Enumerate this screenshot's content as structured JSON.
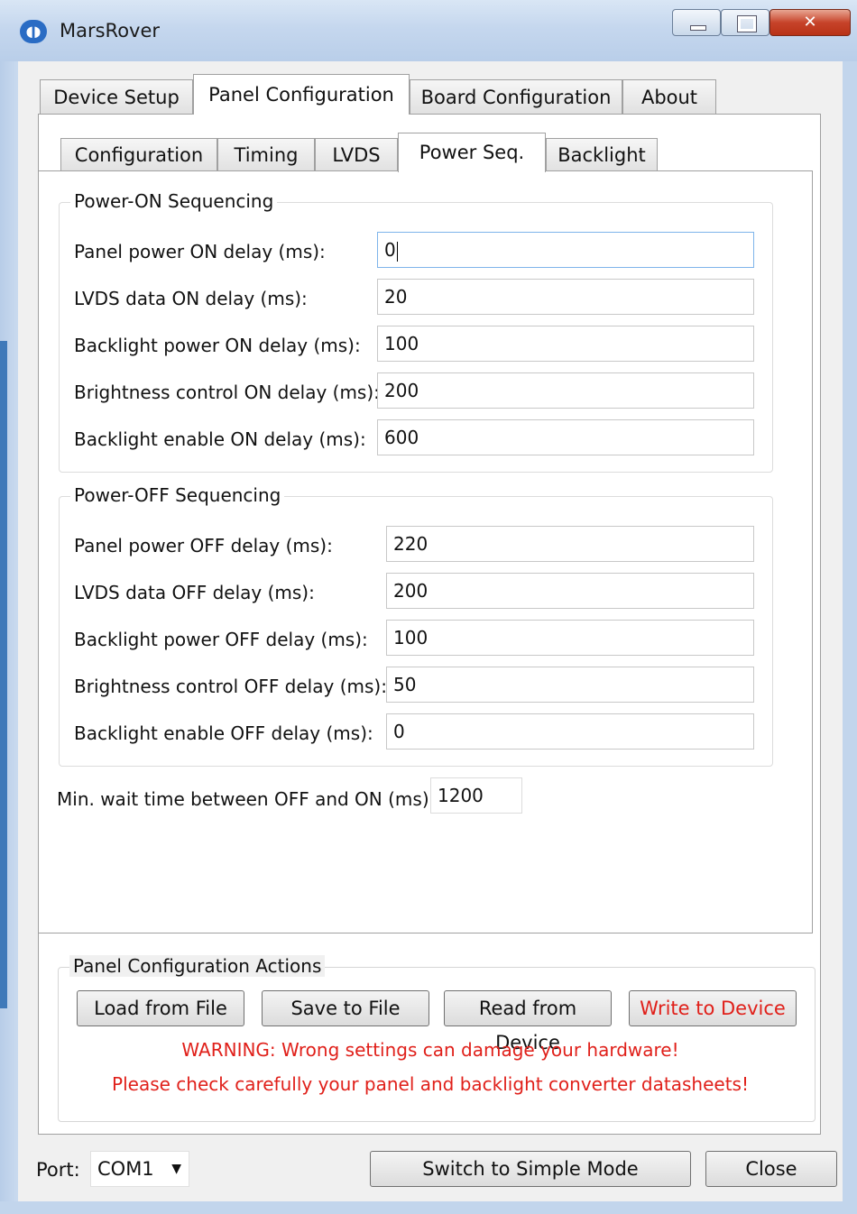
{
  "window": {
    "title": "MarsRover",
    "icon": "app-logo-icon"
  },
  "main_tabs": [
    {
      "label": "Device Setup",
      "active": false
    },
    {
      "label": "Panel Configuration",
      "active": true
    },
    {
      "label": "Board Configuration",
      "active": false
    },
    {
      "label": "About",
      "active": false
    }
  ],
  "sub_tabs": [
    {
      "label": "Configuration",
      "active": false
    },
    {
      "label": "Timing",
      "active": false
    },
    {
      "label": "LVDS",
      "active": false
    },
    {
      "label": "Power Seq.",
      "active": true
    },
    {
      "label": "Backlight",
      "active": false
    }
  ],
  "power_on": {
    "title": "Power-ON Sequencing",
    "fields": [
      {
        "label": "Panel power ON delay (ms):",
        "value": "0"
      },
      {
        "label": "LVDS data ON delay (ms):",
        "value": "20"
      },
      {
        "label": "Backlight power ON delay (ms):",
        "value": "100"
      },
      {
        "label": "Brightness control ON delay (ms):",
        "value": "200"
      },
      {
        "label": "Backlight enable ON delay (ms):",
        "value": "600"
      }
    ]
  },
  "power_off": {
    "title": "Power-OFF Sequencing",
    "fields": [
      {
        "label": "Panel power OFF delay (ms):",
        "value": "220"
      },
      {
        "label": "LVDS data OFF delay (ms):",
        "value": "200"
      },
      {
        "label": "Backlight power OFF delay (ms):",
        "value": "100"
      },
      {
        "label": "Brightness control OFF delay (ms):",
        "value": "50"
      },
      {
        "label": "Backlight enable OFF delay (ms):",
        "value": "0"
      }
    ]
  },
  "min_wait": {
    "label": "Min. wait time between OFF and ON (ms):",
    "value": "1200"
  },
  "actions": {
    "title": "Panel Configuration Actions",
    "load": "Load from File",
    "save": "Save to File",
    "read": "Read from Device",
    "write": "Write to Device",
    "warning1": "WARNING: Wrong settings can damage your hardware!",
    "warning2": "Please check carefully your panel and backlight converter datasheets!"
  },
  "footer": {
    "port_label": "Port:",
    "port_value": "COM1",
    "switch_mode": "Switch to Simple Mode",
    "close": "Close"
  },
  "colors": {
    "warning_text": "#e0201a",
    "focus_border": "#7eb4ea"
  }
}
